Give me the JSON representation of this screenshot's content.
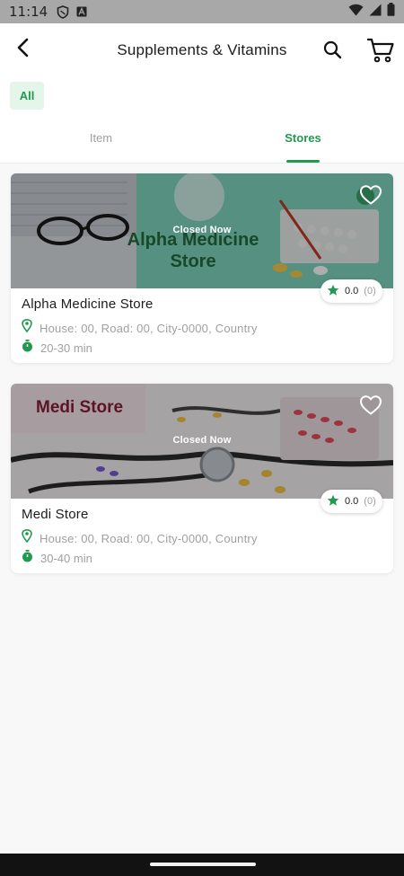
{
  "status_bar": {
    "time": "11:14",
    "icons": [
      "shield-icon",
      "a-badge-icon",
      "wifi-icon",
      "signal-icon",
      "battery-icon"
    ]
  },
  "header": {
    "title": "Supplements & Vitamins",
    "back_icon": "arrow-back-icon",
    "search_icon": "search-icon",
    "cart_icon": "cart-icon"
  },
  "filter": {
    "selected_chip": "All"
  },
  "tabs": [
    {
      "label": "Item",
      "active": false
    },
    {
      "label": "Stores",
      "active": true
    }
  ],
  "colors": {
    "accent": "#1f9a4f",
    "accent_light": "#e4f5ea",
    "muted_text": "#a0a0a0"
  },
  "stores": [
    {
      "name": "Alpha Medicine Store",
      "banner_text_line1": "Alpha Medicine",
      "banner_text_line2": "Store",
      "status_overlay": "Closed Now",
      "rating": "0.0",
      "rating_count": "(0)",
      "address": "House: 00, Road: 00, City-0000, Country",
      "delivery_time": "20-30 min"
    },
    {
      "name": "Medi Store",
      "banner_text_line1": "Medi Store",
      "status_overlay": "Closed Now",
      "rating": "0.0",
      "rating_count": "(0)",
      "address": "House: 00, Road: 00, City-0000, Country",
      "delivery_time": "30-40 min"
    }
  ]
}
